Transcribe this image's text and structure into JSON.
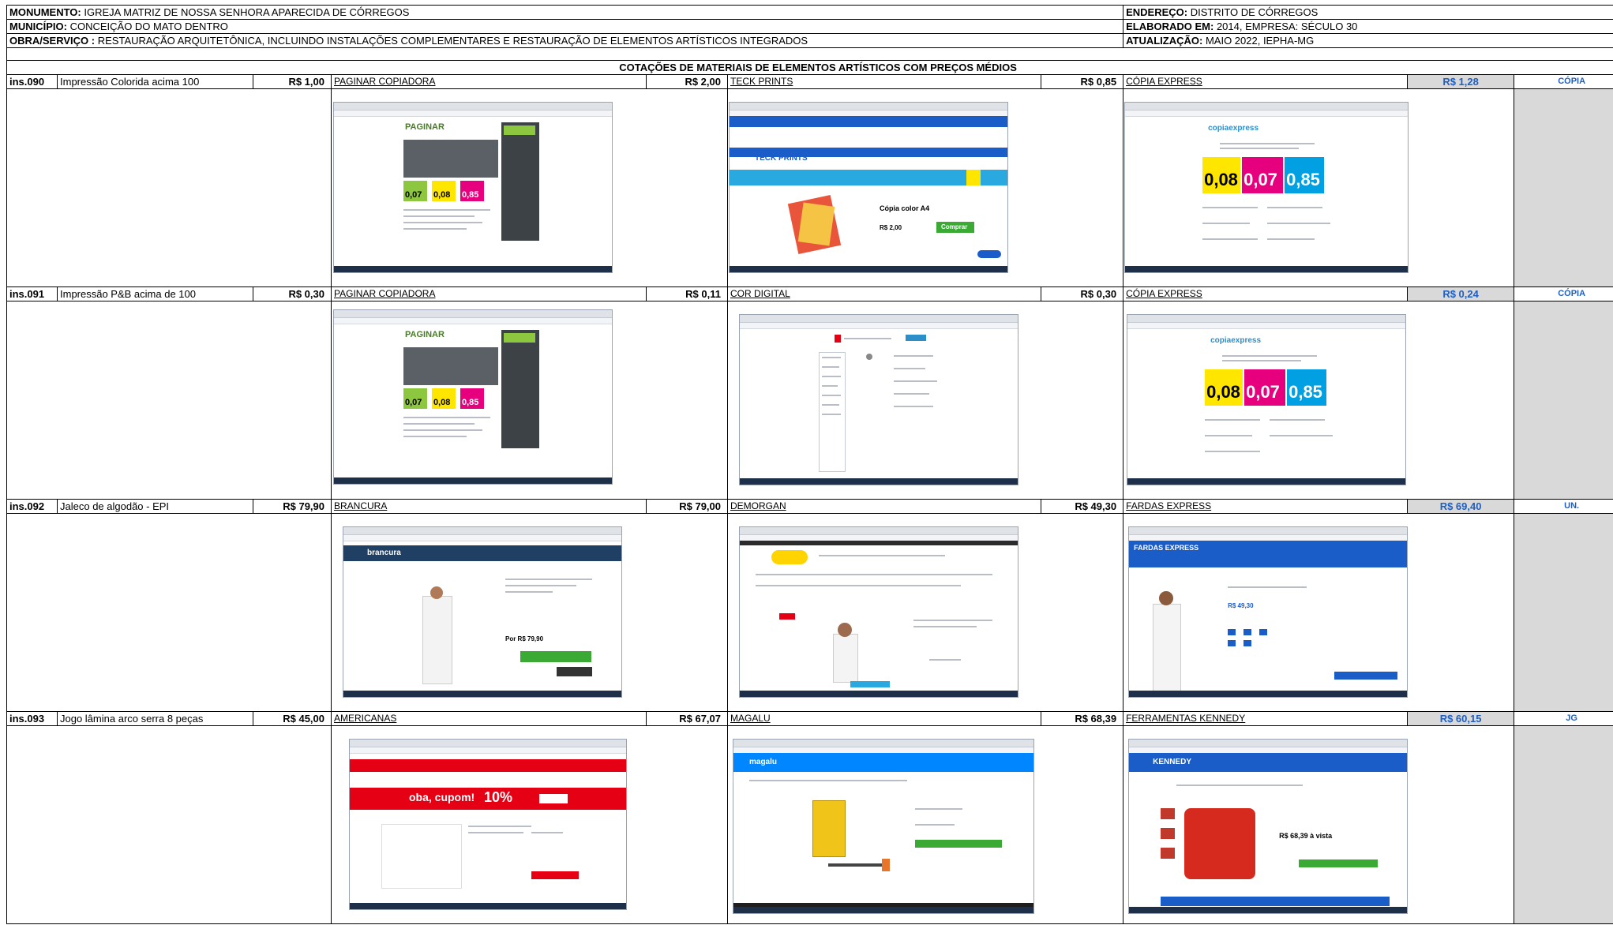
{
  "header": {
    "monumento_label": "MONUMENTO:",
    "monumento": "IGREJA MATRIZ DE NOSSA SENHORA APARECIDA DE CÓRREGOS",
    "municipio_label": "MUNICÍPIO:",
    "municipio": "CONCEIÇÃO DO MATO DENTRO",
    "obra_label": "OBRA/SERVIÇO :",
    "obra": "RESTAURAÇÃO ARQUITETÔNICA, INCLUINDO INSTALAÇÕES COMPLEMENTARES E RESTAURAÇÃO DE ELEMENTOS ARTÍSTICOS INTEGRADOS",
    "endereco_label": "ENDEREÇO:",
    "endereco": "DISTRITO DE CÓRREGOS",
    "elaborado_label": "ELABORADO EM:",
    "elaborado": "2014, EMPRESA: SÉCULO 30",
    "atualizacao_label": "ATUALIZAÇÃO:",
    "atualizacao": "MAIO 2022, IEPHA-MG"
  },
  "section_title": "COTAÇÕES DE MATERIAIS DE ELEMENTOS ARTÍSTICOS COM PREÇOS MÉDIOS",
  "items": [
    {
      "code": "ins.090",
      "description": "Impressão Colorida acima 100",
      "price1": "R$ 1,00",
      "source1": "PAGINAR COPIADORA",
      "price2": "R$ 2,00",
      "source2": "TECK PRINTS",
      "price3": "R$ 0,85",
      "source3": "CÓPIA EXPRESS",
      "average": "R$ 1,28",
      "unit": "CÓPIA"
    },
    {
      "code": "ins.091",
      "description": "Impressão P&B acima de 100",
      "price1": "R$ 0,30",
      "source1": "PAGINAR COPIADORA",
      "price2": "R$ 0,11",
      "source2": "COR DIGITAL",
      "price3": "R$ 0,30",
      "source3": "CÓPIA EXPRESS",
      "average": "R$ 0,24",
      "unit": "CÓPIA"
    },
    {
      "code": "ins.092",
      "description": "Jaleco de algodão - EPI",
      "price1": "R$ 79,90",
      "source1": "BRANCURA",
      "price2": "R$ 79,00",
      "source2": "DEMORGAN",
      "price3": "R$ 49,30",
      "source3": "FARDAS EXPRESS",
      "average": "R$ 69,40",
      "unit": "UN."
    },
    {
      "code": "ins.093",
      "description": "Jogo lâmina arco serra 8 peças",
      "price1": "R$ 45,00",
      "source1": "AMERICANAS",
      "price2": "R$ 67,07",
      "source2": "MAGALU",
      "price3": "R$ 68,39",
      "source3": "FERRAMENTAS KENNEDY",
      "average": "R$ 60,15",
      "unit": "JG"
    }
  ],
  "screenshot_text": {
    "paginar_logo": "PAGINAR",
    "paginar_p1": "0,07",
    "paginar_p2": "0,08",
    "paginar_p3": "0,85",
    "teck_logo": "TECK PRINTS",
    "teck_product": "Cópia color A4",
    "teck_price": "R$ 2,00",
    "teck_buy": "Comprar",
    "copia_logo": "copiaexpress",
    "copia_p1": "0,08",
    "copia_p2": "0,07",
    "copia_p3": "0,85",
    "brancura_logo": "brancura",
    "brancura_price": "Por R$ 79,90",
    "fardas_logo": "FARDAS EXPRESS",
    "fardas_price": "R$ 49,30",
    "americanas_promo": "oba, cupom!",
    "americanas_pct": "10%",
    "magalu_logo": "magalu",
    "kennedy_logo": "KENNEDY",
    "kennedy_price": "R$ 68,39 à vista"
  },
  "colors": {
    "avg_fill": "#d9d9d9",
    "avg_text": "#1f5fbf",
    "green": "#8dc63f",
    "yellow": "#ffe600",
    "magenta": "#e6007e",
    "cyan": "#00a0e3",
    "red": "#e60014",
    "blue": "#1a5cc8"
  }
}
